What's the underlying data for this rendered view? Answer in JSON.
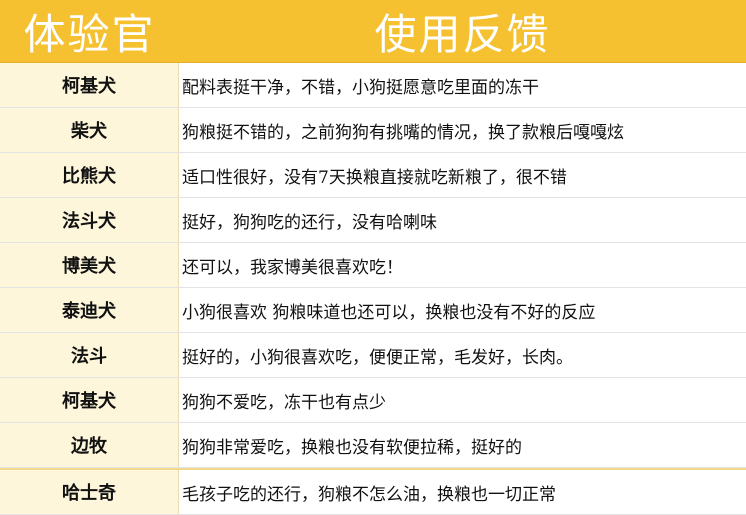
{
  "header": {
    "name_col": "体验官",
    "feedback_col": "使用反馈"
  },
  "rows": [
    {
      "name": "柯基犬",
      "feedback": "配料表挺干净，不错，小狗挺愿意吃里面的冻干"
    },
    {
      "name": "柴犬",
      "feedback": "狗粮挺不错的，之前狗狗有挑嘴的情况，换了款粮后嘎嘎炫"
    },
    {
      "name": "比熊犬",
      "feedback": "适口性很好，没有7天换粮直接就吃新粮了，很不错"
    },
    {
      "name": "法斗犬",
      "feedback": "挺好，狗狗吃的还行，没有哈喇味"
    },
    {
      "name": "博美犬",
      "feedback": "还可以，我家博美很喜欢吃！"
    },
    {
      "name": "泰迪犬",
      "feedback": "小狗很喜欢 狗粮味道也还可以，换粮也没有不好的反应"
    },
    {
      "name": "法斗",
      "feedback": "挺好的，小狗很喜欢吃，便便正常，毛发好，长肉。"
    },
    {
      "name": "柯基犬",
      "feedback": "狗狗不爱吃，冻干也有点少"
    },
    {
      "name": "边牧",
      "feedback": "狗狗非常爱吃，换粮也没有软便拉稀，挺好的"
    },
    {
      "name": "哈士奇",
      "feedback": "毛孩子吃的还行，狗粮不怎么油，换粮也一切正常"
    }
  ],
  "colors": {
    "header_bg": "#F5C130",
    "name_cell_bg": "#FDF6DB"
  }
}
